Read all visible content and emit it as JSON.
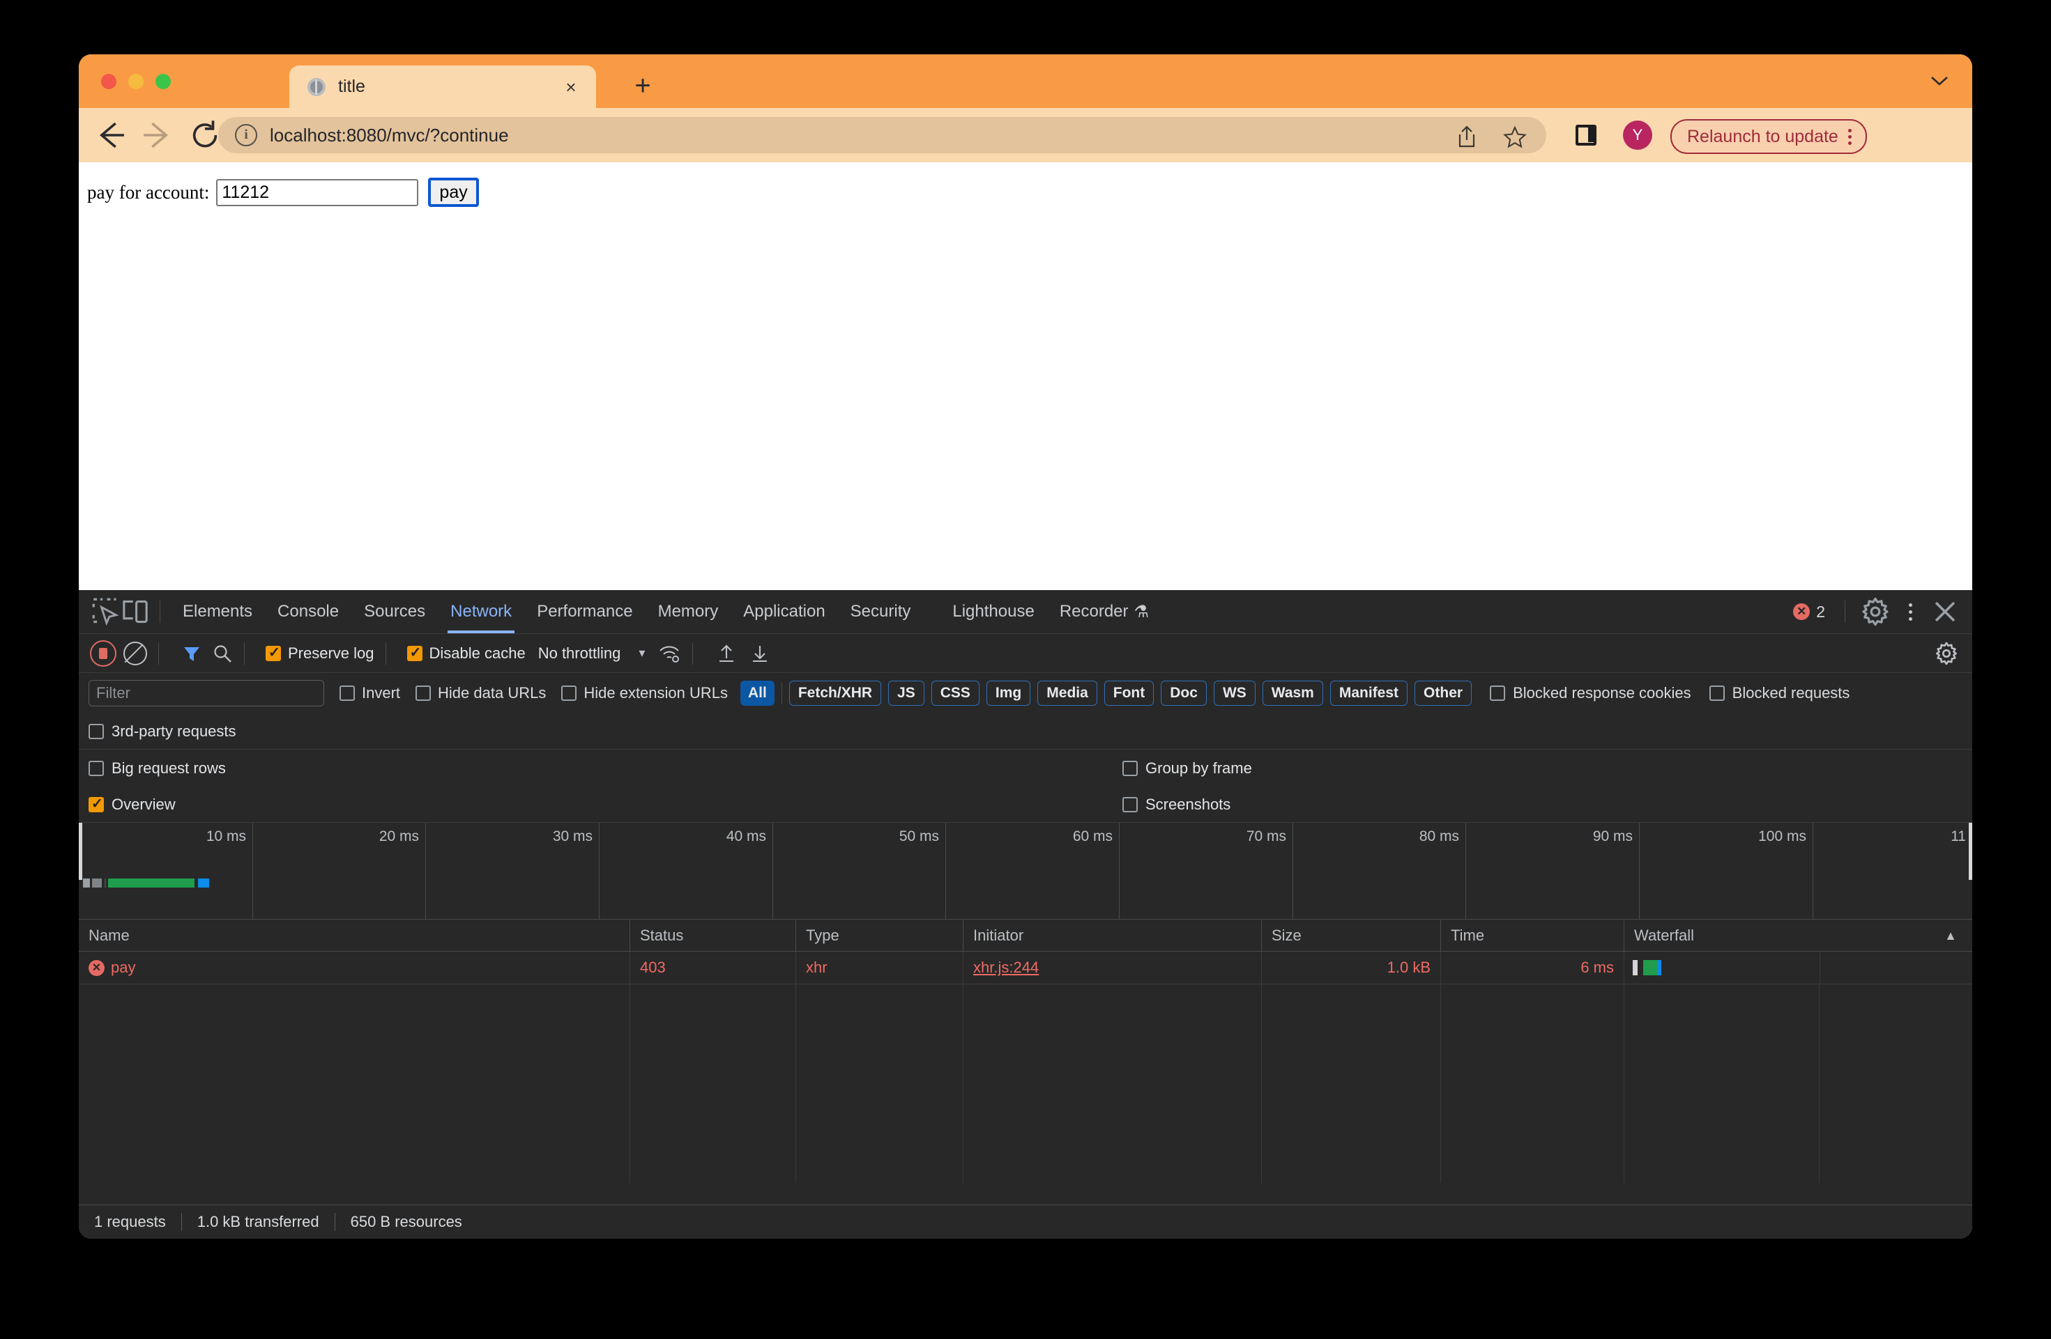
{
  "browser": {
    "tab": {
      "title": "title",
      "favicon": "globe-icon",
      "close": "×"
    },
    "new_tab": "+",
    "url": "localhost:8080/mvc/?continue",
    "info_glyph": "i",
    "avatar_initial": "Y",
    "relaunch_label": "Relaunch to update",
    "back": "←",
    "forward": "→",
    "reload": "⟳"
  },
  "page": {
    "label": "pay for account:",
    "account_value": "11212",
    "account_placeholder": "",
    "pay_button": "pay"
  },
  "devtools": {
    "tabs": [
      {
        "label": "Elements",
        "active": false
      },
      {
        "label": "Console",
        "active": false
      },
      {
        "label": "Sources",
        "active": false
      },
      {
        "label": "Network",
        "active": true
      },
      {
        "label": "Performance",
        "active": false
      },
      {
        "label": "Memory",
        "active": false
      },
      {
        "label": "Application",
        "active": false
      },
      {
        "label": "Security",
        "active": false
      },
      {
        "label": "Lighthouse",
        "active": false
      },
      {
        "label": "Recorder",
        "active": false
      }
    ],
    "recorder_suffix": "⚗",
    "error_count": "2",
    "error_glyph": "✕",
    "close_glyph": "✕",
    "network_toolbar": {
      "preserve_log": "Preserve log",
      "preserve_log_checked": true,
      "disable_cache": "Disable cache",
      "disable_cache_checked": true,
      "throttling": "No throttling"
    },
    "filters": {
      "filter_placeholder": "Filter",
      "filter_value": "",
      "invert": "Invert",
      "hide_data_urls": "Hide data URLs",
      "hide_extension_urls": "Hide extension URLs",
      "types": [
        "All",
        "Fetch/XHR",
        "JS",
        "CSS",
        "Img",
        "Media",
        "Font",
        "Doc",
        "WS",
        "Wasm",
        "Manifest",
        "Other"
      ],
      "active_type": "All",
      "blocked_response_cookies": "Blocked response cookies",
      "blocked_requests": "Blocked requests"
    },
    "options": {
      "third_party": "3rd-party requests",
      "third_party_checked": false,
      "big_request_rows": "Big request rows",
      "big_request_rows_checked": false,
      "group_by_frame": "Group by frame",
      "group_by_frame_checked": false,
      "overview": "Overview",
      "overview_checked": true,
      "screenshots": "Screenshots",
      "screenshots_checked": false
    },
    "overview_ticks": [
      "10 ms",
      "20 ms",
      "30 ms",
      "40 ms",
      "50 ms",
      "60 ms",
      "70 ms",
      "80 ms",
      "90 ms",
      "100 ms",
      "11"
    ],
    "table": {
      "columns": [
        "Name",
        "Status",
        "Type",
        "Initiator",
        "Size",
        "Time",
        "Waterfall"
      ],
      "sort_indicator": "▲",
      "rows": [
        {
          "name": "pay",
          "status": "403",
          "type": "xhr",
          "initiator": "xhr.js:244",
          "size": "1.0 kB",
          "time": "6 ms",
          "error": true
        }
      ]
    },
    "status_bar": {
      "requests": "1 requests",
      "transferred": "1.0 kB transferred",
      "resources": "650 B resources"
    }
  },
  "colors": {
    "chrome_orange": "#f99b44",
    "chrome_toolbar": "#fbd9ae",
    "devtools_bg": "#282828",
    "accent_blue": "#8ab4f8",
    "error_red": "#ef6b63",
    "checkbox_on": "#f29900",
    "waterfall_green": "#1f9d4d",
    "waterfall_blue": "#0b8ce8",
    "avatar": "#b8255f"
  }
}
